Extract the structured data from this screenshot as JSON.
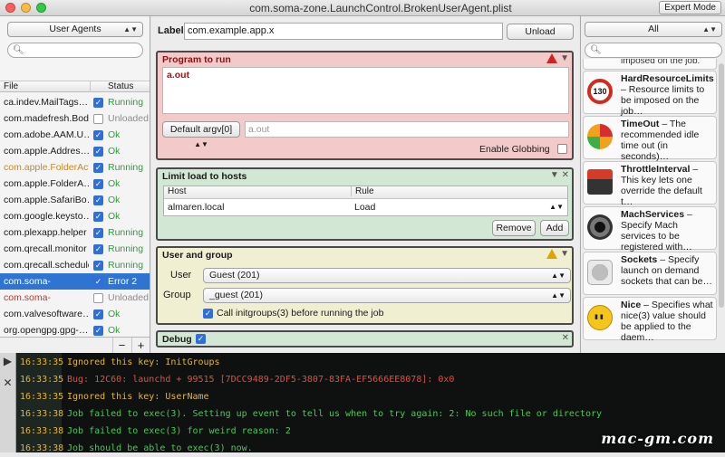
{
  "window": {
    "title": "com.soma-zone.LaunchControl.BrokenUserAgent.plist",
    "expert_label": "Expert Mode"
  },
  "sidebar": {
    "domain_select": "User Agents",
    "search_placeholder": "",
    "columns": {
      "file": "File",
      "status": "Status"
    },
    "items": [
      {
        "file": "ca.indev.MailTags…",
        "checked": true,
        "status": "Running",
        "status_color": "#2e9e3a",
        "file_color": "#1a1a1a"
      },
      {
        "file": "com.madefresh.Bode…",
        "checked": false,
        "status": "Unloaded",
        "status_color": "#8c8c8c",
        "file_color": "#1a1a1a"
      },
      {
        "file": "com.adobe.AAM.U…",
        "checked": true,
        "status": "Ok",
        "status_color": "#2e9e3a",
        "file_color": "#1a1a1a"
      },
      {
        "file": "com.apple.Addres…",
        "checked": true,
        "status": "Ok",
        "status_color": "#2e9e3a",
        "file_color": "#1a1a1a"
      },
      {
        "file": "com.apple.FolderActi",
        "checked": true,
        "status": "Running",
        "status_color": "#2e9e3a",
        "file_color": "#c98a1a"
      },
      {
        "file": "com.apple.FolderA…",
        "checked": true,
        "status": "Ok",
        "status_color": "#2e9e3a",
        "file_color": "#1a1a1a"
      },
      {
        "file": "com.apple.SafariBo…",
        "checked": true,
        "status": "Ok",
        "status_color": "#2e9e3a",
        "file_color": "#1a1a1a"
      },
      {
        "file": "com.google.keysto…",
        "checked": true,
        "status": "Ok",
        "status_color": "#2e9e3a",
        "file_color": "#1a1a1a"
      },
      {
        "file": "com.plexapp.helper",
        "checked": true,
        "status": "Running",
        "status_color": "#2e9e3a",
        "file_color": "#1a1a1a"
      },
      {
        "file": "com.qrecall.monitor",
        "checked": true,
        "status": "Running",
        "status_color": "#2e9e3a",
        "file_color": "#1a1a1a"
      },
      {
        "file": "com.qrecall.scheduler",
        "checked": true,
        "status": "Running",
        "status_color": "#2e9e3a",
        "file_color": "#1a1a1a"
      },
      {
        "file": "com.soma-",
        "checked": true,
        "status": "Error 2",
        "status_color": "#ffffff",
        "file_color": "#ffffff",
        "selected": true
      },
      {
        "file": "com.soma-",
        "checked": false,
        "status": "Unloaded",
        "status_color": "#8c8c8c",
        "file_color": "#c0392b"
      },
      {
        "file": "com.valvesoftware…",
        "checked": true,
        "status": "Ok",
        "status_color": "#2e9e3a",
        "file_color": "#1a1a1a"
      },
      {
        "file": "org.opengpg.gpg-…",
        "checked": true,
        "status": "Ok",
        "status_color": "#2e9e3a",
        "file_color": "#1a1a1a"
      }
    ],
    "add_label": "+",
    "remove_label": "−"
  },
  "editor": {
    "label_caption": "Label",
    "label_value": "com.example.app.x",
    "unload_label": "Unload",
    "program": {
      "title": "Program to run",
      "value": "a.out",
      "argv_select": "Default argv[0]",
      "argv_placeholder": "a.out",
      "globbing_label": "Enable Globbing",
      "color": "#f3caca"
    },
    "hosts": {
      "title": "Limit load to hosts",
      "col_host": "Host",
      "col_rule": "Rule",
      "rows": [
        {
          "host": "almaren.local",
          "rule": "Load"
        }
      ],
      "remove_label": "Remove",
      "add_label": "Add",
      "color": "#d3e8d4"
    },
    "user_group": {
      "title": "User and group",
      "user_label": "User",
      "user_value": "Guest (201)",
      "group_label": "Group",
      "group_value": "_guest (201)",
      "initgroups_label": "Call initgroups(3) before running the job",
      "color": "#f1efd1"
    },
    "debug": {
      "title": "Debug",
      "color": "#d3e8d4"
    }
  },
  "library": {
    "filter_select": "All",
    "search_placeholder": "",
    "partial_text": "imposed on the job.",
    "items": [
      {
        "icon": "speed-limit-icon",
        "title": "HardResourceLimits",
        "desc": "Resource limits to be imposed on the job…"
      },
      {
        "icon": "timer-icon",
        "title": "TimeOut",
        "desc": "The recommended idle time out (in seconds)…"
      },
      {
        "icon": "lever-icon",
        "title": "ThrottleInterval",
        "desc": "This key lets one override the default t…"
      },
      {
        "icon": "speaker-icon",
        "title": "MachServices",
        "desc": "Specify Mach services to be registered with…"
      },
      {
        "icon": "socket-icon",
        "title": "Sockets",
        "desc": "Specify launch on demand sockets that can be…"
      },
      {
        "icon": "smiley-icon",
        "title": "Nice",
        "desc": "Specifies what nice(3) value should be applied to the daem…"
      }
    ]
  },
  "console": {
    "lines": [
      {
        "time": "16:33:35",
        "msg": "Ignored this key: InitGroups",
        "color": "#e6b430"
      },
      {
        "time": "16:33:35",
        "msg": "Bug: 12C60: launchd + 99515 [7DCC9489-2DF5-3807-83FA-EF5666EE8078]: 0x0",
        "color": "#e0503c"
      },
      {
        "time": "16:33:35",
        "msg": "Ignored this key: UserName",
        "color": "#e6b430"
      },
      {
        "time": "16:33:38",
        "msg": "Job failed to exec(3). Setting up event to tell us when to try again: 2: No such file or directory",
        "color": "#3fcf4f"
      },
      {
        "time": "16:33:38",
        "msg": "Job failed to exec(3) for weird reason: 2",
        "color": "#3fcf4f"
      },
      {
        "time": "16:33:38",
        "msg": "Job should be able to exec(3) now.",
        "color": "#3fcf4f"
      }
    ],
    "play_icon": "▶",
    "clear_icon": "✕"
  },
  "watermark": "mac-gm.com"
}
